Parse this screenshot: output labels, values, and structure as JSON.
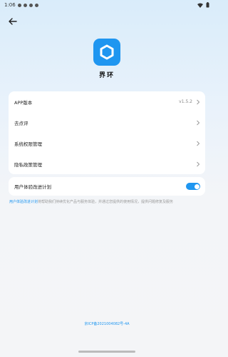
{
  "status_bar": {
    "time": "1:06"
  },
  "header": {
    "back_icon": "arrow-left-icon"
  },
  "app": {
    "icon": "hexagon-logo-icon",
    "name": "界环",
    "accent": "#1f96f0"
  },
  "settings": {
    "items": [
      {
        "label": "APP版本",
        "value": "v1.5.2"
      },
      {
        "label": "去点评",
        "value": ""
      },
      {
        "label": "系统权限管理",
        "value": ""
      },
      {
        "label": "隐私政策管理",
        "value": ""
      }
    ]
  },
  "ux_program": {
    "label": "用户体验改进计划",
    "enabled": true
  },
  "description": {
    "link": "用户体验改进计划",
    "text": "将帮助我们持续优化产品与服务体验，并通过您提供的使用情况，提供问题修复及服务"
  },
  "footer": {
    "icp": "京ICP备2021004082号-4A"
  }
}
